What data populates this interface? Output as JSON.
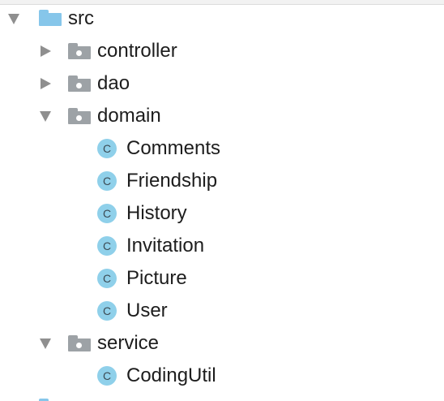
{
  "tree": {
    "src_label": "src",
    "controller_label": "controller",
    "dao_label": "dao",
    "domain_label": "domain",
    "classes_domain": [
      "Comments",
      "Friendship",
      "History",
      "Invitation",
      "Picture",
      "User"
    ],
    "service_label": "service",
    "classes_service": [
      "CodingUtil"
    ],
    "class_glyph": "C"
  },
  "icons": {
    "package_folder": "package-folder-icon",
    "source_folder": "source-folder-icon",
    "class": "java-class-icon",
    "expanded": "chevron-down-icon",
    "collapsed": "chevron-right-icon"
  },
  "colors": {
    "source_folder": "#86c6ea",
    "package_folder": "#9da2a6",
    "class_icon": "#8fd0ea",
    "arrow": "#8f8f8f",
    "text": "#1d1d1d"
  }
}
